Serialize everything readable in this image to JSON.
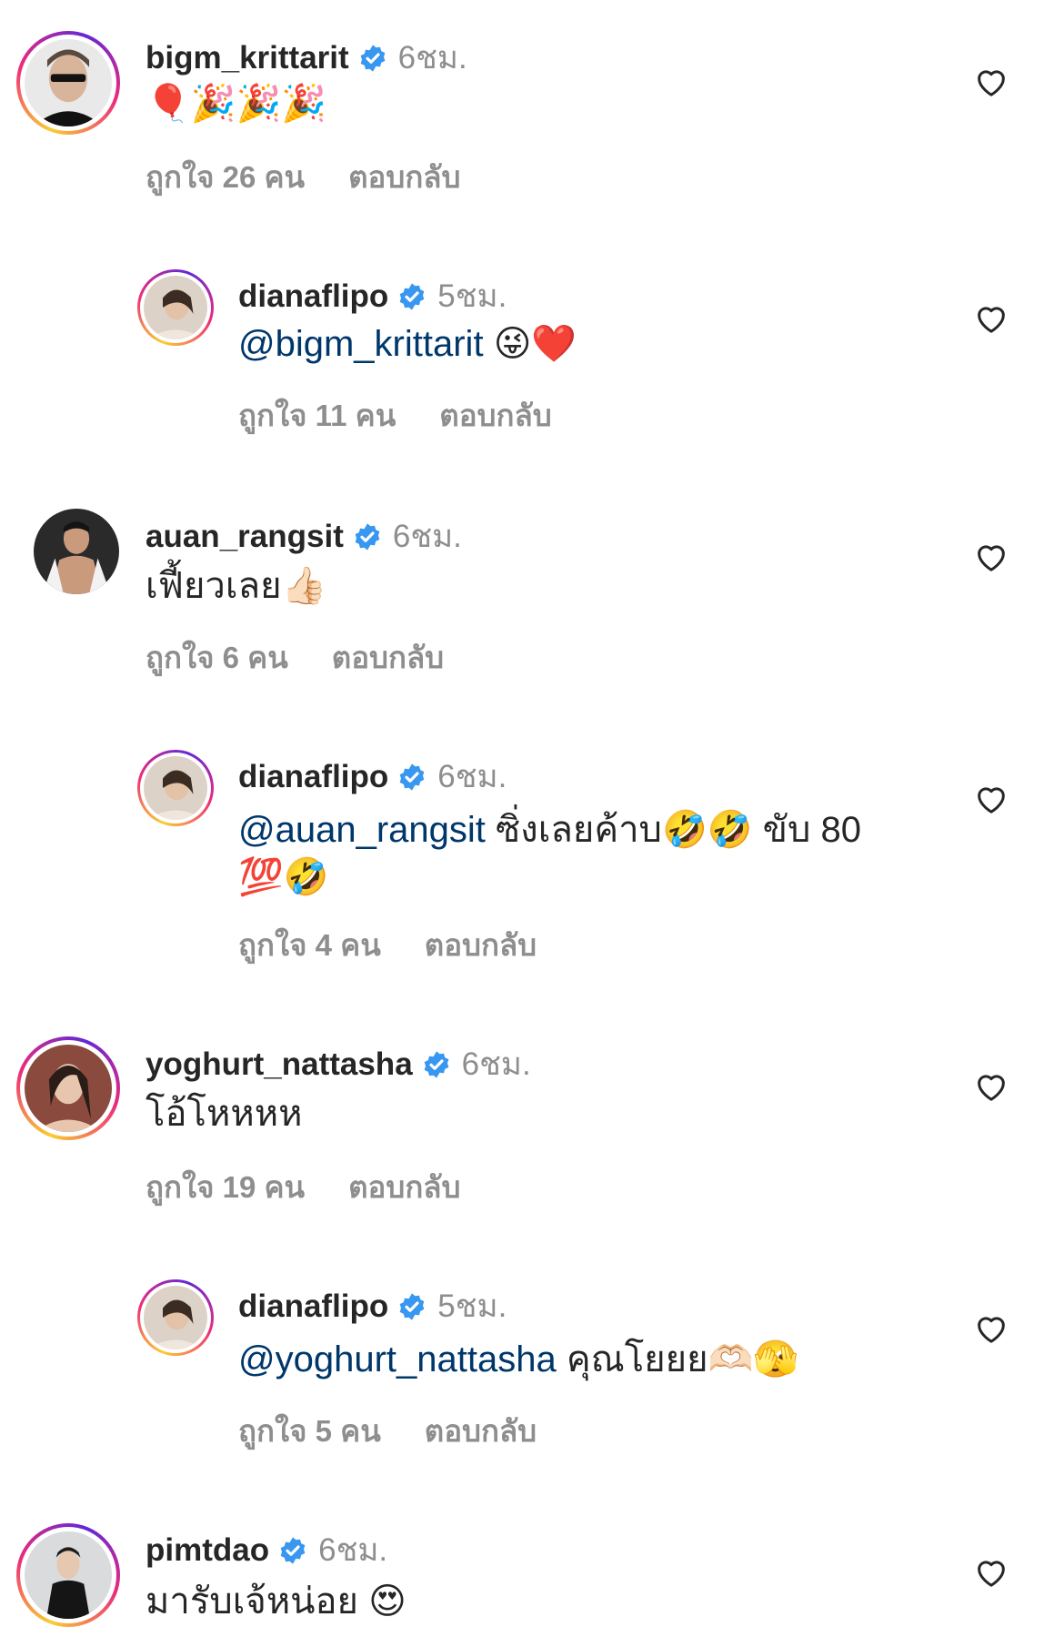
{
  "like_suffix": "คน",
  "like_prefix": "ถูกใจ",
  "reply_label": "ตอบกลับ",
  "comments": [
    {
      "username": "bigm_krittarit",
      "time": "6ชม.",
      "mention": "",
      "text": "",
      "emoji": "🎈🎉🎉🎉",
      "likes": "26",
      "level": 0
    },
    {
      "username": "dianaflipo",
      "time": "5ชม.",
      "mention": "@bigm_krittarit",
      "text": "",
      "emoji": "😜❤️",
      "likes": "11",
      "level": 1
    },
    {
      "username": "auan_rangsit",
      "time": "6ชม.",
      "mention": "",
      "text": "เฟี้ยวเลย",
      "emoji": "👍🏻",
      "likes": "6",
      "level": 0
    },
    {
      "username": "dianaflipo",
      "time": "6ชม.",
      "mention": "@auan_rangsit",
      "text": " ซิ่งเลยค้าบ",
      "emoji": "🤣🤣",
      "text2": " ขับ 80",
      "line2": "💯🤣",
      "likes": "4",
      "level": 1
    },
    {
      "username": "yoghurt_nattasha",
      "time": "6ชม.",
      "mention": "",
      "text": "โอ้โหหหห",
      "emoji": "",
      "likes": "19",
      "level": 0
    },
    {
      "username": "dianaflipo",
      "time": "5ชม.",
      "mention": "@yoghurt_nattasha",
      "text": " คุณโยยย",
      "emoji": "🫶🏻🫣",
      "likes": "5",
      "level": 1
    },
    {
      "username": "pimtdao",
      "time": "6ชม.",
      "mention": "",
      "text": "มารับเจ้หน่อย",
      "emoji": "😍",
      "likes": "",
      "level": 0
    }
  ],
  "colors": {
    "mention": "#00376b",
    "muted": "#8e8e8e",
    "verified": "#3897f0"
  }
}
